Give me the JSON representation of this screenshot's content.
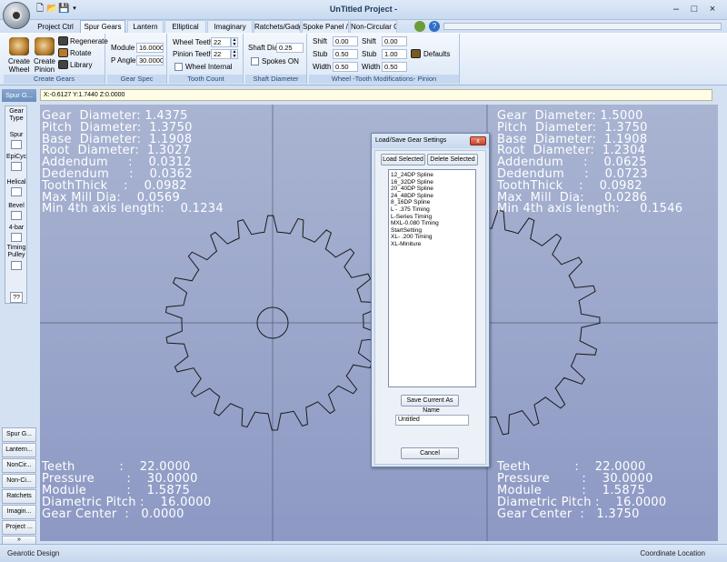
{
  "window": {
    "title": "UnTitled Project -",
    "min": "–",
    "max": "□",
    "close": "×"
  },
  "tabs": [
    "Project Ctrl",
    "Spur Gears",
    "Lantern",
    "Elliptical",
    "Imaginary",
    "Ratchets/Gadg",
    "Spoke Panel /",
    "Non-Circular Ge"
  ],
  "active_tab": "Spur Gears",
  "ribbon": {
    "create_gears": {
      "create_wheel": "Create Wheel",
      "create_pinion": "Create Pinion",
      "regenerate": "Regenerate",
      "rotate": "Rotate",
      "library": "Library",
      "label": "Create Gears"
    },
    "gear_spec": {
      "module_label": "Module",
      "module_value": "16.0000",
      "p_angle_label": "P Angle",
      "p_angle_value": "30.0000",
      "label": "Gear Spec"
    },
    "tooth_count": {
      "wheel_teeth_label": "Wheel Teeth",
      "wheel_teeth_value": "22",
      "pinion_teeth_label": "Pinion Teeth",
      "pinion_teeth_value": "22",
      "wheel_internal_label": "Wheel Internal",
      "label": "Tooth Count"
    },
    "shaft_diameter": {
      "shaft_dia_label": "Shaft Dia.",
      "shaft_dia_value": "0.25",
      "spokes_on_label": "Spokes ON",
      "label": "Shaft Diameter"
    },
    "tooth_mods": {
      "wheel_shift_label": "Shift",
      "wheel_shift_value": "0.00",
      "wheel_stub_label": "Stub",
      "wheel_stub_value": "0.50",
      "wheel_width_label": "Width",
      "wheel_width_value": "0.50",
      "pinion_shift_label": "Shift",
      "pinion_shift_value": "0.00",
      "pinion_stub_label": "Stub",
      "pinion_stub_value": "1.00",
      "pinion_width_label": "Width",
      "pinion_width_value": "0.50",
      "defaults": "Defaults",
      "label": "Wheel -Tooth Modifications- Pinion"
    }
  },
  "sidebar": {
    "top_button": "Spur G...",
    "gear_type_label": "Gear Type",
    "types": [
      "Spur",
      "EpiCyc",
      "Helical",
      "Bevel",
      "4-bar",
      "Timing Pulley"
    ],
    "help": "??",
    "nav": [
      "Spur G...",
      "Lantern...",
      "NonCir...",
      "Non-Ci...",
      "Ratchets",
      "Imagin...",
      "Project ...",
      "»"
    ]
  },
  "coordinates": "X:-0.6127 Y:1.7440 Z:0.0000",
  "left_gear_info": [
    "Gear  Diameter: 1.4375",
    "Pitch  Diameter:  1.3750",
    "Base  Diameter:  1.1908",
    "Root  Diameter:  1.3027",
    "Addendum     :    0.0312",
    "Dedendum     :    0.0362",
    "ToothThick    :    0.0982",
    "Max Mill Dia:    0.0569",
    "Min 4th axis length:    0.1234"
  ],
  "right_gear_info": [
    "Gear  Diameter: 1.5000",
    "Pitch  Diameter:  1.3750",
    "Base  Diameter:  1.1908",
    "Root  Diameter:  1.2304",
    "Addendum     :    0.0625",
    "Dedendum     :    0.0723",
    "ToothThick    :    0.0982",
    "Max  Mill  Dia:     0.0286",
    "Min 4th axis length:     0.1546"
  ],
  "left_gear_params": [
    "Teeth           :    22.0000",
    "Pressure        :    30.0000",
    "Module          :    1.5875",
    "Diametric Pitch :    16.0000",
    "Gear Center  :   0.0000"
  ],
  "right_gear_params": [
    "Teeth           :    22.0000",
    "Pressure        :    30.0000",
    "Module          :    1.5875",
    "Diametric Pitch :    16.0000",
    "Gear Center  :   1.3750"
  ],
  "dialog": {
    "title": "Load/Save Gear Settings",
    "close": "x",
    "load_selected": "Load Selected",
    "delete_selected": "Delete Selected",
    "items": [
      "12_24DP Spline",
      "16_32DP Spline",
      "20_40DP Spline",
      "24_48DP Spline",
      "8_16DP Spline",
      "L - .375 Timing",
      "L-Series Timing",
      "MXL-0.080 Timing",
      "StartSetting",
      "XL- .200 Timing",
      "XL-Miniture"
    ],
    "save_current_as": "Save Current As",
    "name_label": "Name",
    "name_value": "Untitled",
    "cancel": "Cancel"
  },
  "status": {
    "left": "Gearotic Design",
    "right": "Coordinate Location"
  }
}
